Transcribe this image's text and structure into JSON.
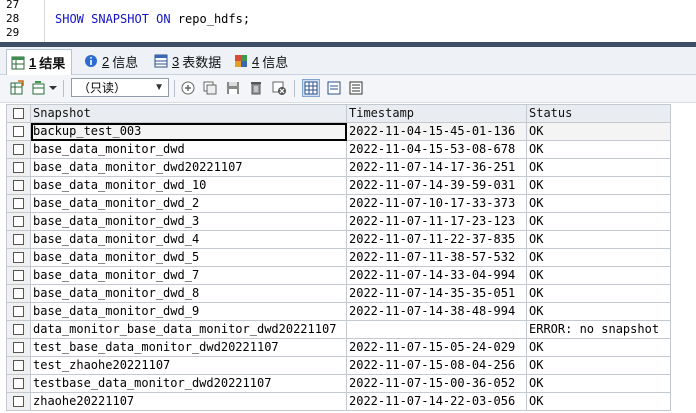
{
  "editor": {
    "line_numbers": [
      "27",
      "28",
      "29"
    ],
    "code": {
      "kw1": "SHOW SNAPSHOT ON",
      "rest": " repo_hdfs;"
    }
  },
  "tabs": [
    {
      "num": "1",
      "label": "结果",
      "icon": "grid-results-icon"
    },
    {
      "num": "2",
      "label": "信息",
      "icon": "info-icon"
    },
    {
      "num": "3",
      "label": "表数据",
      "icon": "table-data-icon"
    },
    {
      "num": "4",
      "label": "信息",
      "icon": "tables-info-icon"
    }
  ],
  "toolbar": {
    "mode_select": "（只读）"
  },
  "grid": {
    "columns": [
      "Snapshot",
      "Timestamp",
      "Status"
    ],
    "rows": [
      [
        "backup_test_003",
        "2022-11-04-15-45-01-136",
        "OK"
      ],
      [
        "base_data_monitor_dwd",
        "2022-11-04-15-53-08-678",
        "OK"
      ],
      [
        "base_data_monitor_dwd20221107",
        "2022-11-07-14-17-36-251",
        "OK"
      ],
      [
        "base_data_monitor_dwd_10",
        "2022-11-07-14-39-59-031",
        "OK"
      ],
      [
        "base_data_monitor_dwd_2",
        "2022-11-07-10-17-33-373",
        "OK"
      ],
      [
        "base_data_monitor_dwd_3",
        "2022-11-07-11-17-23-123",
        "OK"
      ],
      [
        "base_data_monitor_dwd_4",
        "2022-11-07-11-22-37-835",
        "OK"
      ],
      [
        "base_data_monitor_dwd_5",
        "2022-11-07-11-38-57-532",
        "OK"
      ],
      [
        "base_data_monitor_dwd_7",
        "2022-11-07-14-33-04-994",
        "OK"
      ],
      [
        "base_data_monitor_dwd_8",
        "2022-11-07-14-35-35-051",
        "OK"
      ],
      [
        "base_data_monitor_dwd_9",
        "2022-11-07-14-38-48-994",
        "OK"
      ],
      [
        "data_monitor_base_data_monitor_dwd20221107",
        "",
        "ERROR: no snapshot"
      ],
      [
        "test_base_data_monitor_dwd20221107",
        "2022-11-07-15-05-24-029",
        "OK"
      ],
      [
        "test_zhaohe20221107",
        "2022-11-07-15-08-04-256",
        "OK"
      ],
      [
        "testbase_data_monitor_dwd20221107",
        "2022-11-07-15-00-36-052",
        "OK"
      ],
      [
        "zhaohe20221107",
        "2022-11-07-14-22-03-056",
        "OK"
      ]
    ]
  }
}
